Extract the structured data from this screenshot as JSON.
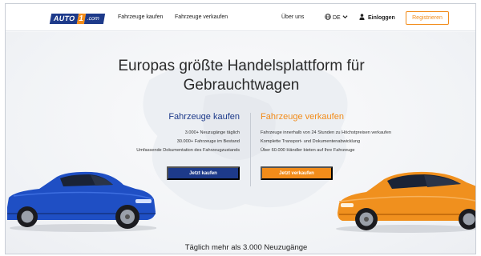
{
  "header": {
    "logo": {
      "auto": "AUTO",
      "one": "1",
      "com": ".com"
    },
    "nav": {
      "buy": "Fahrzeuge kaufen",
      "sell": "Fahrzeuge verkaufen"
    },
    "about": "Über uns",
    "language": "DE",
    "login": "Einloggen",
    "register": "Registrieren"
  },
  "hero": {
    "title_line1": "Europas größte Handelsplattform für",
    "title_line2": "Gebrauchtwagen",
    "buy": {
      "heading": "Fahrzeuge kaufen",
      "lines": [
        "3.000+ Neuzugänge täglich",
        "30.000+ Fahrzeuge im Bestand",
        "Umfassende Dokumentation des Fahrzeugzustands"
      ],
      "button": "Jetzt kaufen"
    },
    "sell": {
      "heading": "Fahrzeuge verkaufen",
      "lines": [
        "Fahrzeuge innerhalb von 24 Stunden zu Höchstpreisen verkaufen",
        "Komplette Transport- und Dokumentenabwicklung",
        "Über 60.000 Händler bieten auf Ihre Fahrzeuge"
      ],
      "button": "Jetzt verkaufen"
    }
  },
  "section": {
    "title": "Täglich mehr als 3.000 Neuzugänge"
  },
  "icons": {
    "globe": "globe-icon",
    "chevron": "chevron-down-icon",
    "user": "user-icon"
  },
  "colors": {
    "brand_blue": "#1d3a8a",
    "brand_orange": "#f28c1a",
    "car_blue": "#1f4fc4",
    "car_orange": "#f0901e"
  }
}
